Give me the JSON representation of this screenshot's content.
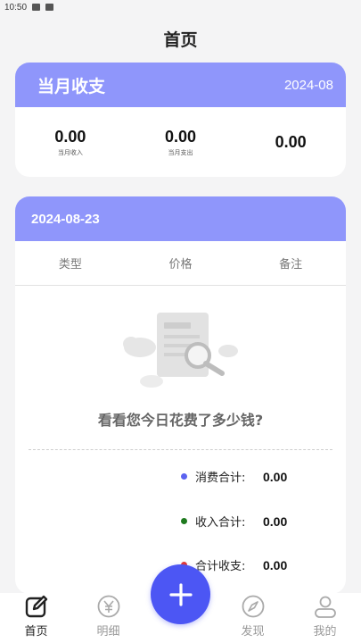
{
  "status_bar": {
    "time": "10:50"
  },
  "page_title": "首页",
  "month_card": {
    "title": "当月收支",
    "date": "2024-08",
    "stats": [
      {
        "value": "0.00",
        "label": "当月收入"
      },
      {
        "value": "0.00",
        "label": "当月支出"
      },
      {
        "value": "0.00",
        "label": ""
      }
    ]
  },
  "day_card": {
    "date": "2024-08-23",
    "columns": [
      "类型",
      "价格",
      "备注"
    ],
    "empty_text": "看看您今日花费了多少钱?",
    "summary": [
      {
        "label": "消费合计:",
        "value": "0.00",
        "color": "#5b63f0"
      },
      {
        "label": "收入合计:",
        "value": "0.00",
        "color": "#1f7a1f"
      },
      {
        "label": "合计收支:",
        "value": "0.00",
        "color": "#e53935"
      }
    ]
  },
  "tabs": [
    {
      "label": "首页",
      "icon": "edit-icon",
      "active": true
    },
    {
      "label": "明细",
      "icon": "yen-icon",
      "active": false
    },
    {
      "label": "发现",
      "icon": "compass-icon",
      "active": false
    },
    {
      "label": "我的",
      "icon": "user-icon",
      "active": false
    }
  ],
  "colors": {
    "header": "#8f96fb",
    "fab": "#4c56f4"
  }
}
